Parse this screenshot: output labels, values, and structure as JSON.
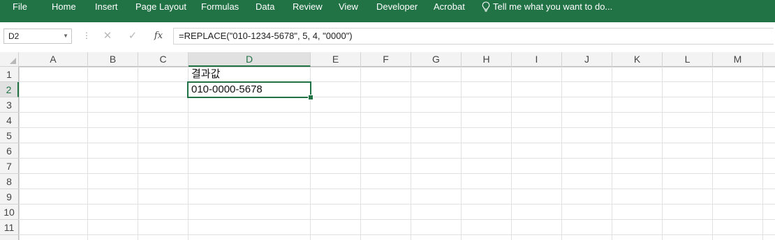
{
  "ribbon": {
    "tabs": [
      {
        "label": "File"
      },
      {
        "label": "Home"
      },
      {
        "label": "Insert"
      },
      {
        "label": "Page Layout"
      },
      {
        "label": "Formulas"
      },
      {
        "label": "Data"
      },
      {
        "label": "Review"
      },
      {
        "label": "View"
      },
      {
        "label": "Developer"
      },
      {
        "label": "Acrobat"
      }
    ],
    "tell_me": "Tell me what you want to do...",
    "color": "#217346"
  },
  "formula_bar": {
    "name_box": "D2",
    "cancel_icon": "✕",
    "enter_icon": "✓",
    "fx_label": "fx",
    "formula": "=REPLACE(\"010-1234-5678\", 5, 4, \"0000\")"
  },
  "sheet": {
    "columns": [
      "A",
      "B",
      "C",
      "D",
      "E",
      "F",
      "G",
      "H",
      "I",
      "J",
      "K",
      "L",
      "M"
    ],
    "rows": [
      "1",
      "2",
      "3",
      "4",
      "5",
      "6",
      "7",
      "8",
      "9",
      "10",
      "11"
    ],
    "selected_cell": "D2",
    "cells": {
      "D1": "결과값",
      "D2": "010-0000-5678"
    }
  }
}
